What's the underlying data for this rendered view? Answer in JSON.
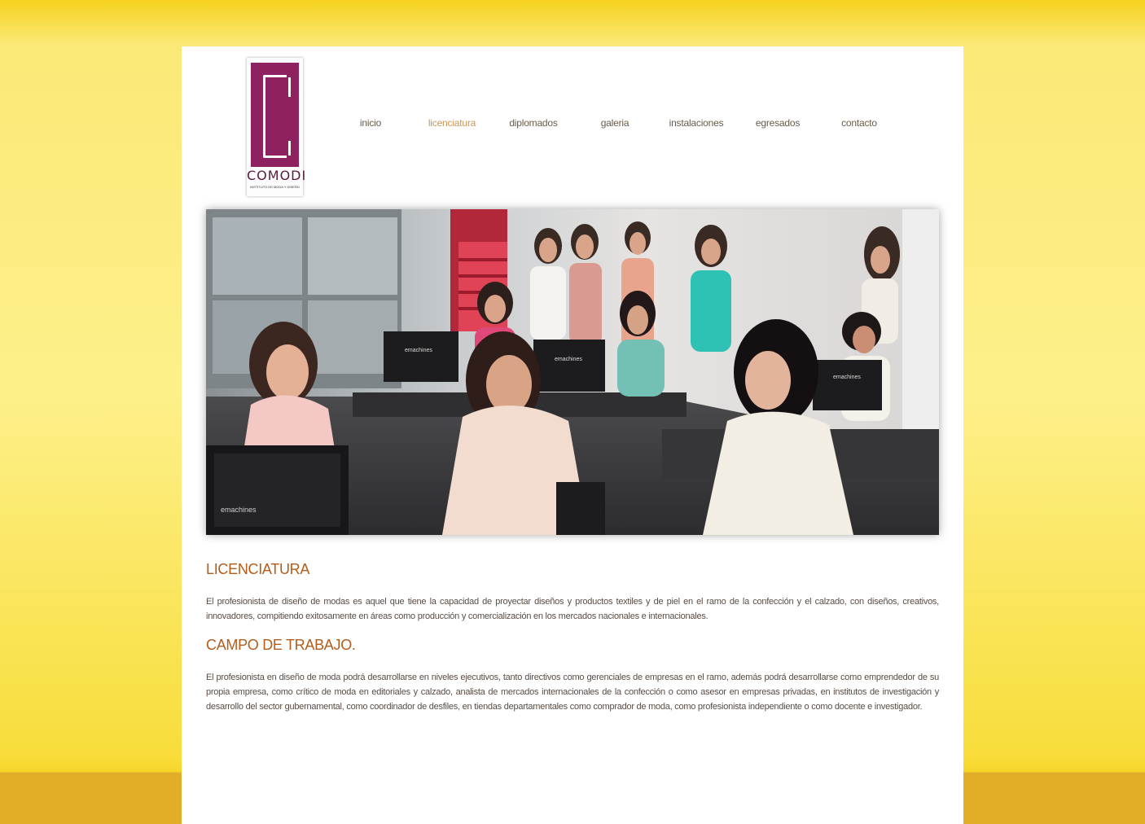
{
  "logo": {
    "name": "COMODI",
    "tagline": "INSTITUTO DE MODA Y DISEÑO"
  },
  "nav": {
    "items": [
      {
        "label": "inicio"
      },
      {
        "label": "licenciatura",
        "active": true
      },
      {
        "label": "diplomados"
      },
      {
        "label": "galeria"
      },
      {
        "label": "instalaciones"
      },
      {
        "label": "egresados"
      },
      {
        "label": "contacto"
      }
    ]
  },
  "hero": {
    "monitor_brand": "emachines"
  },
  "content": {
    "section1": {
      "title": "LICENCIATURA",
      "text": "El profesionista de diseño de modas es aquel que tiene la capacidad de proyectar diseños y productos textiles y de piel en el ramo de la confección y el calzado, con diseños, creativos, innovadores, compitiendo exitosamente en áreas como producción y comercialización en los mercados nacionales e internacionales."
    },
    "section2": {
      "title": "CAMPO DE TRABAJO.",
      "text": "El profesionista en diseño de moda podrá desarrollarse en niveles ejecutivos, tanto directivos como gerenciales de empresas en el ramo, además podrá desarrollarse como emprendedor de su propia empresa, como crítico de moda en editoriales y calzado, analista de mercados internacionales de la confección o como asesor en empresas privadas, en institutos de investigación y desarrollo del sector gubernamental, como coordinador de desfiles, en tiendas departamentales como comprador de moda, como profesionista independiente o como docente e investigador."
    }
  },
  "colors": {
    "accent": "#c9955a",
    "heading": "#b45c1a",
    "logo": "#8e2160",
    "background": "#f5d21e"
  }
}
